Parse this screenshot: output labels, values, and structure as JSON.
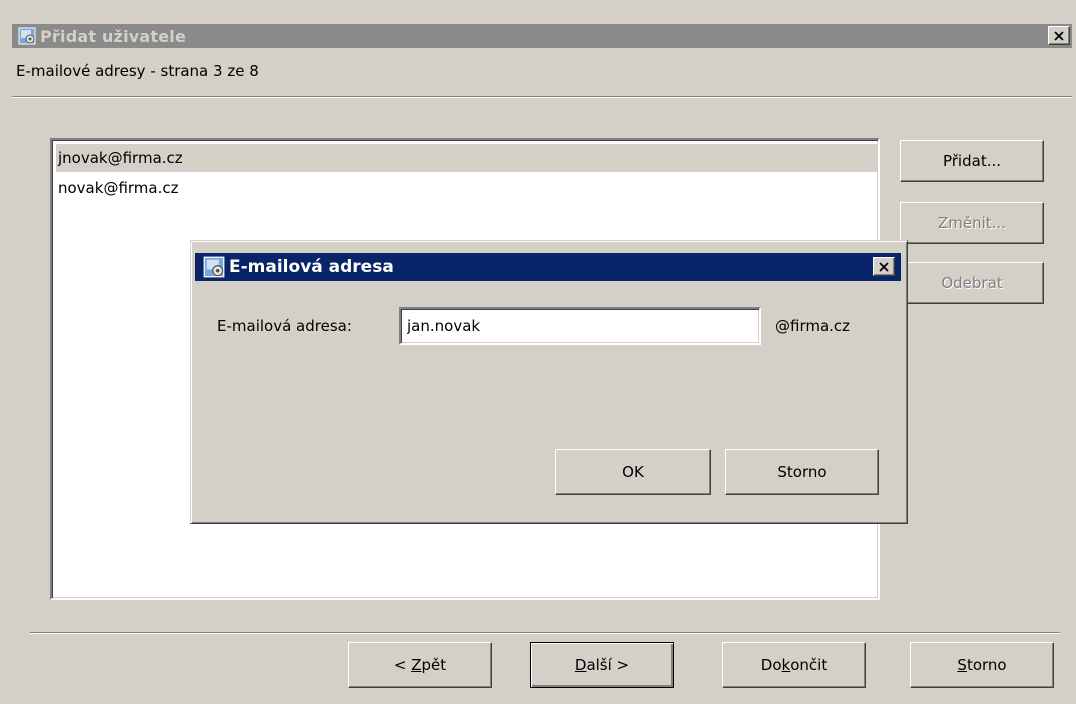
{
  "window": {
    "title": "Přidat uživatele",
    "subtitle": "E-mailové adresy - strana 3 ze 8",
    "icon": "app-icon",
    "close_icon": "close-icon"
  },
  "email_list": {
    "items": [
      "jnovak@firma.cz",
      "novak@firma.cz"
    ],
    "selected_index": 0
  },
  "side_buttons": {
    "add": "Přidat...",
    "change": "Změnit...",
    "remove": "Odebrat"
  },
  "nav": {
    "back_prefix": "< ",
    "back_key": "Z",
    "back_rest": "pět",
    "next_key": "D",
    "next_rest": "alší >",
    "finish_pre": "Do",
    "finish_key": "k",
    "finish_rest": "ončit",
    "cancel_key": "S",
    "cancel_rest": "torno"
  },
  "dialog": {
    "title": "E-mailová adresa",
    "label": "E-mailová adresa:",
    "input_value": "jan.novak",
    "domain": "@firma.cz",
    "ok": "OK",
    "cancel": "Storno"
  },
  "colors": {
    "active_title": "#0a246a",
    "inactive_title": "#8a8a8a",
    "face": "#d4d0c8"
  }
}
